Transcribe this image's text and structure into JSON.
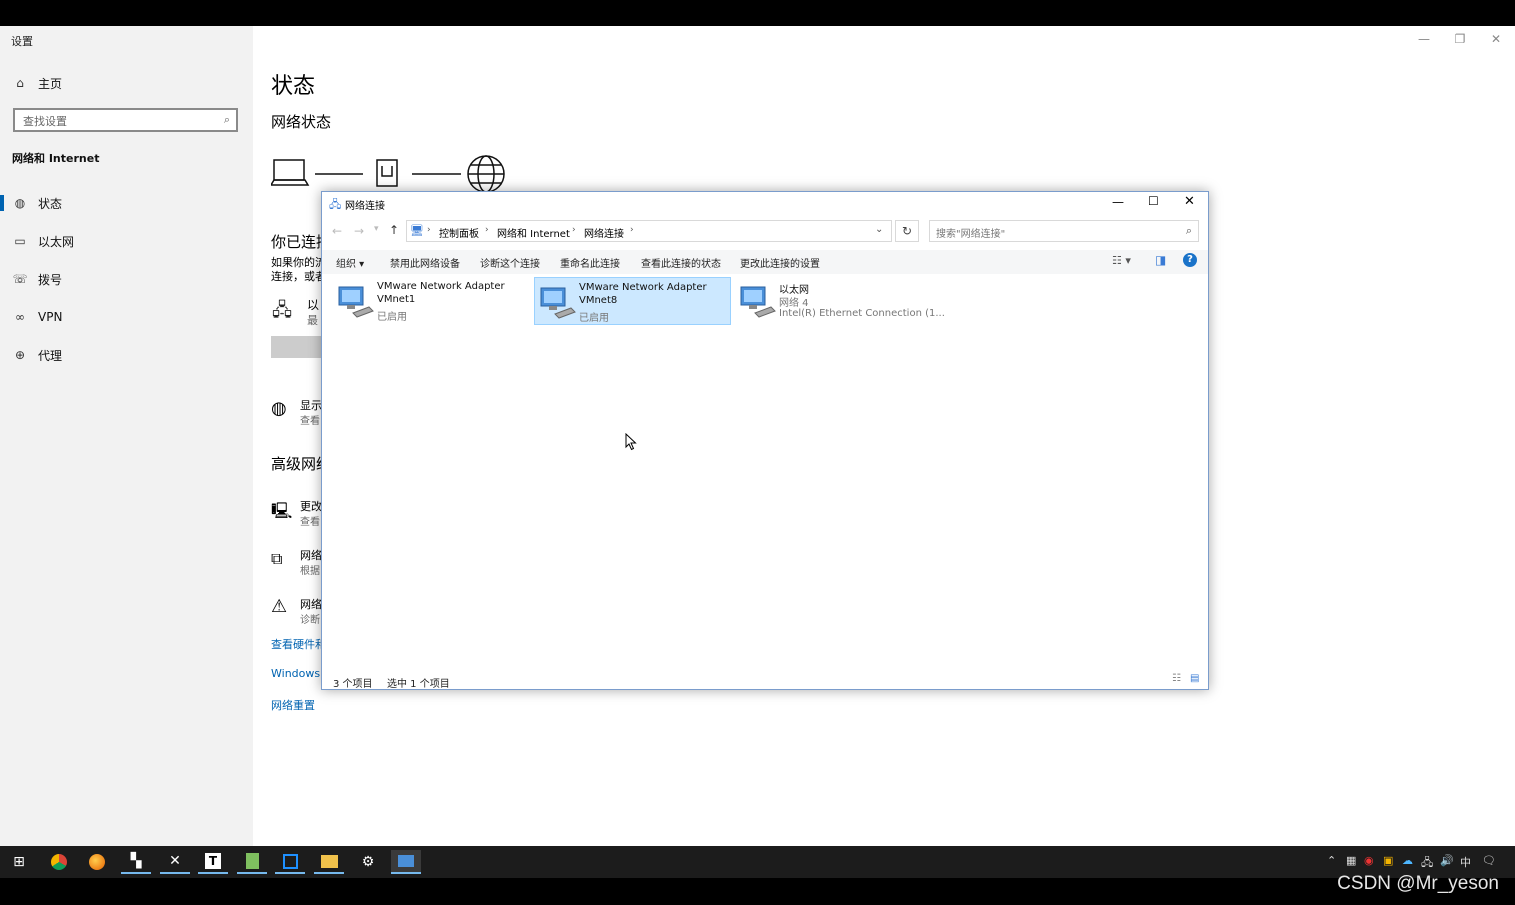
{
  "settings": {
    "window_title": "设置",
    "caption": {
      "minimize": "—",
      "restore": "❐",
      "close": "✕"
    },
    "sidebar": {
      "home": "主页",
      "search_placeholder": "查找设置",
      "section_title": "网络和 Internet",
      "items": [
        {
          "label": "状态",
          "icon": "globe-status-icon",
          "active": true
        },
        {
          "label": "以太网",
          "icon": "ethernet-icon",
          "active": false
        },
        {
          "label": "拨号",
          "icon": "dialup-icon",
          "active": false
        },
        {
          "label": "VPN",
          "icon": "vpn-icon",
          "active": false
        },
        {
          "label": "代理",
          "icon": "proxy-globe-icon",
          "active": false
        }
      ]
    },
    "main": {
      "title": "状态",
      "subtitle": "网络状态",
      "connected_heading": "你已连接",
      "connected_desc_1": "如果你的流",
      "connected_desc_2": "连接，或者",
      "connection_name": "以",
      "connection_sub": "最",
      "show_available_title": "显示",
      "show_available_sub": "查看",
      "advanced_heading": "高级网络",
      "adv_items": [
        {
          "title": "更改",
          "sub": "查看"
        },
        {
          "title": "网络",
          "sub": "根据"
        },
        {
          "title": "网络",
          "sub": "诊断"
        }
      ],
      "links": [
        "查看硬件和",
        "Windows F",
        "网络重置"
      ]
    }
  },
  "network_connections": {
    "title": "网络连接",
    "breadcrumb": [
      "控制面板",
      "网络和 Internet",
      "网络连接"
    ],
    "search_placeholder": "搜索\"网络连接\"",
    "commands": [
      "组织 ▾",
      "禁用此网络设备",
      "诊断这个连接",
      "重命名此连接",
      "查看此连接的状态",
      "更改此连接的设置"
    ],
    "items": [
      {
        "name": "VMware Network Adapter",
        "line2": "VMnet1",
        "line3": "已启用",
        "selected": false
      },
      {
        "name": "VMware Network Adapter",
        "line2": "VMnet8",
        "line3": "已启用",
        "selected": true
      },
      {
        "name": "以太网",
        "line2": "网络 4",
        "line3": "Intel(R) Ethernet Connection (1...",
        "selected": false
      }
    ],
    "status_count": "3 个项目",
    "status_selected": "选中 1 个项目"
  },
  "taskbar": {
    "apps": [
      "chrome-icon",
      "firefox-icon",
      "terminal-icon",
      "xshell-icon",
      "typora-icon",
      "notepad-icon",
      "vscode-icon",
      "file-explorer-icon",
      "settings-gear-icon",
      "network-connections-icon"
    ],
    "ime": "中"
  },
  "watermark": "CSDN @Mr_yeson"
}
